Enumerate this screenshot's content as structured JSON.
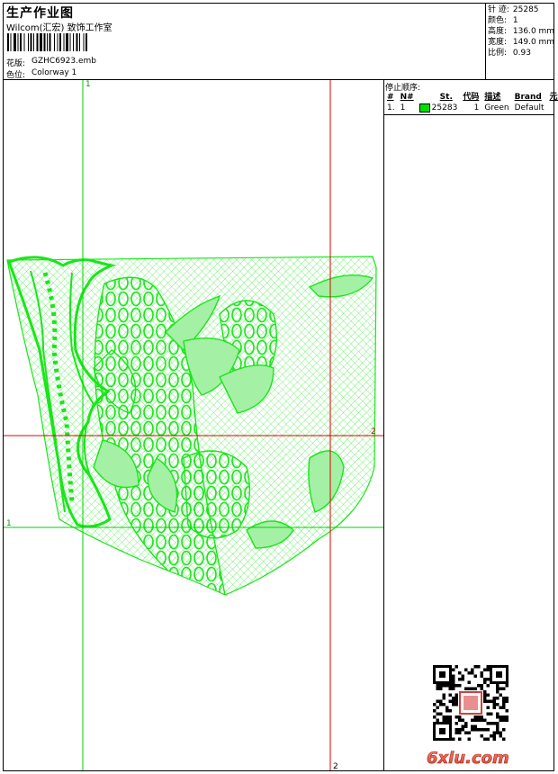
{
  "header": {
    "title": "生产作业图",
    "company": "Wilcom(汇宏) 致饰工作室",
    "design_label": "花版:",
    "design_value": "GZHC6923.emb",
    "colorway_label": "色位:",
    "colorway_value": "Colorway 1"
  },
  "stats": [
    {
      "label": "针 迹:",
      "value": "25285"
    },
    {
      "label": "颜色:",
      "value": "1"
    },
    {
      "label": "高度:",
      "value": "136.0 mm"
    },
    {
      "label": "宽度:",
      "value": "149.0 mm"
    },
    {
      "label": "比例:",
      "value": "0.93"
    }
  ],
  "stop_sequence": {
    "title": "停止顺序:",
    "columns": [
      "#",
      "N#",
      "St.",
      "代码",
      "描述",
      "Brand",
      "元素"
    ],
    "rows": [
      {
        "idx": "1.",
        "needle": "1",
        "stitches": "25283",
        "code": "1",
        "description": "Green",
        "brand": "Default",
        "color": "#00e000"
      }
    ]
  },
  "guides": {
    "v1_top": "1",
    "h1_left": "1",
    "h2_right": "2",
    "v2_bottom": "2"
  },
  "colors": {
    "thread": "#19e619",
    "guide_green": "#00d200",
    "guide_red": "#e00000"
  },
  "watermark": "6xiu.com"
}
